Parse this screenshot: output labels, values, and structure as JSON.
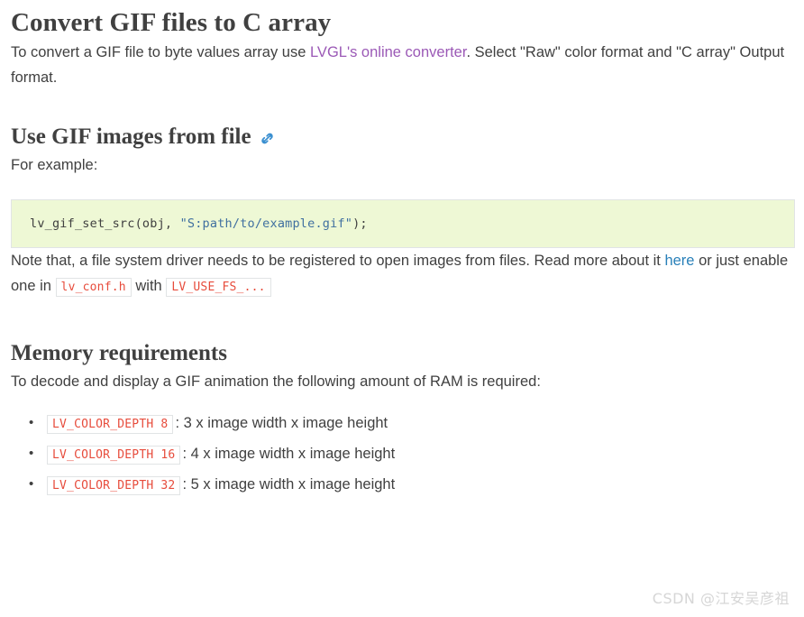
{
  "document": {
    "h1_title": "Convert GIF files to C array",
    "intro_paragraph": {
      "before_link": "To convert a GIF file to byte values array use ",
      "link_text": "LVGL's online converter",
      "after_link": ". Select \"Raw\" color format and \"C array\" Output format.",
      "link_color": "#9b59b6"
    },
    "section_file": {
      "heading": "Use GIF images from file",
      "anchor_icon": "link-chain-icon",
      "anchor_icon_color": "#2980b9",
      "example_label": "For example:",
      "code_block": {
        "background": "#eef8d5",
        "segments": {
          "call": "lv_gif_set_src(obj, ",
          "string": "\"S:path/to/example.gif\"",
          "tail": ");"
        },
        "string_color": "#4070a0"
      },
      "note_paragraph": {
        "part1": "Note that, a file system driver needs to be registered to open images from files. Read more about it ",
        "link_text": "here",
        "part2": " or just enable one in ",
        "code1": "lv_conf.h",
        "part3": " with ",
        "code2": "LV_USE_FS_...",
        "link_color": "#2980b9",
        "inline_code_color": "#e74c3c"
      }
    },
    "section_memory": {
      "heading": "Memory requirements",
      "intro": "To decode and display a GIF animation the following amount of RAM is required:",
      "items": [
        {
          "code": "LV_COLOR_DEPTH 8",
          "text": ": 3 x image width x image height"
        },
        {
          "code": "LV_COLOR_DEPTH 16",
          "text": ": 4 x image width x image height"
        },
        {
          "code": "LV_COLOR_DEPTH 32",
          "text": ": 5 x image width x image height"
        }
      ]
    },
    "watermark": "CSDN @江安吴彦祖"
  }
}
